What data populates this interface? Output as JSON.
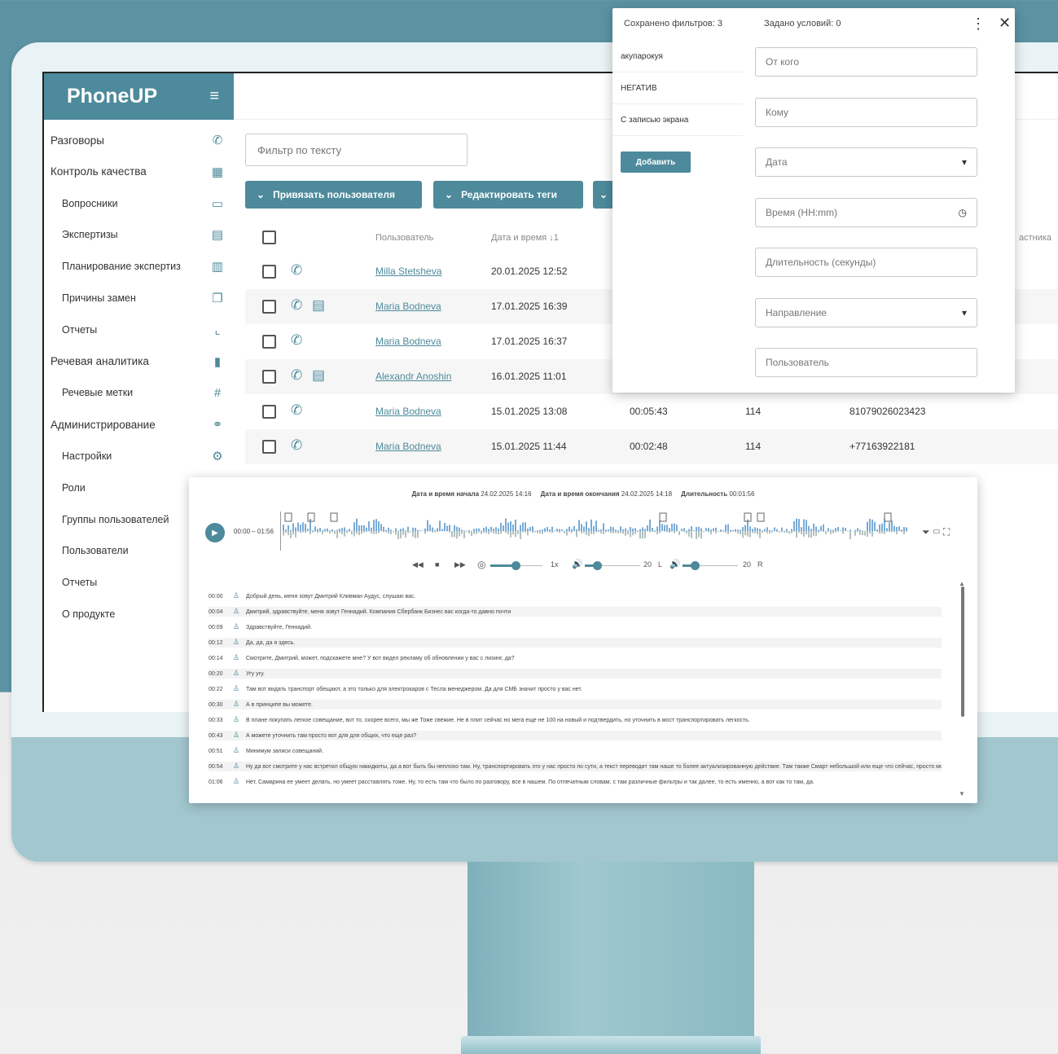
{
  "app": {
    "name": "PhoneUP"
  },
  "sidebar": {
    "items": [
      {
        "label": "Разговоры",
        "icon": "phone-icon",
        "glyph": "✆"
      },
      {
        "label": "Контроль качества",
        "icon": "qm-icon",
        "glyph": "▦"
      },
      {
        "label": "Вопросники",
        "icon": "folder-icon",
        "glyph": "▭"
      },
      {
        "label": "Экспертизы",
        "icon": "calendar-search-icon",
        "glyph": "▤"
      },
      {
        "label": "Планирование экспертиз",
        "icon": "calendar-clock-icon",
        "glyph": "▥"
      },
      {
        "label": "Причины замен",
        "icon": "copy-icon",
        "glyph": "❐"
      },
      {
        "label": "Отчеты",
        "icon": "chart-line-icon",
        "glyph": "⌞"
      },
      {
        "label": "Речевая аналитика",
        "icon": "bar-chart-icon",
        "glyph": "▮"
      },
      {
        "label": "Речевые метки",
        "icon": "hash-icon",
        "glyph": "#"
      },
      {
        "label": "Администрирование",
        "icon": "admin-icon",
        "glyph": "⚭"
      },
      {
        "label": "Настройки",
        "icon": "gear-icon",
        "glyph": "⚙"
      },
      {
        "label": "Роли",
        "icon": "",
        "glyph": ""
      },
      {
        "label": "Группы пользователей",
        "icon": "",
        "glyph": ""
      },
      {
        "label": "Пользователи",
        "icon": "",
        "glyph": ""
      },
      {
        "label": "Отчеты",
        "icon": "",
        "glyph": ""
      },
      {
        "label": "О продукте",
        "icon": "",
        "glyph": ""
      }
    ]
  },
  "main": {
    "filter_placeholder": "Фильтр по тексту",
    "buttons": [
      "Привязать пользователя",
      "Редактировать теги"
    ],
    "columns": {
      "user": "Пользователь",
      "datetime": "Дата и время",
      "last": "астника"
    },
    "rows": [
      {
        "user": "Milla Stetsheva",
        "datetime": "20.01.2025 12:52",
        "duration": "",
        "ext": "",
        "number": "",
        "transcript": false
      },
      {
        "user": "Maria Bodneva",
        "datetime": "17.01.2025 16:39",
        "duration": "",
        "ext": "",
        "number": "",
        "transcript": true
      },
      {
        "user": "Maria Bodneva",
        "datetime": "17.01.2025 16:37",
        "duration": "",
        "ext": "",
        "number": "",
        "transcript": false
      },
      {
        "user": "Alexandr Anoshin",
        "datetime": "16.01.2025 11:01",
        "duration": "",
        "ext": "",
        "number": "",
        "transcript": true
      },
      {
        "user": "Maria Bodneva",
        "datetime": "15.01.2025 13:08",
        "duration": "00:05:43",
        "ext": "114",
        "number": "81079026023423",
        "transcript": false
      },
      {
        "user": "Maria Bodneva",
        "datetime": "15.01.2025 11:44",
        "duration": "00:02:48",
        "ext": "114",
        "number": "+77163922181",
        "transcript": false
      }
    ]
  },
  "filter_panel": {
    "saved_count": "Сохранено фильтров: 3",
    "conditions_count": "Задано условий: 0",
    "saved_filters": [
      "акупарокуя",
      "НЕГАТИВ",
      "С записью экрана"
    ],
    "add_label": "Добавить",
    "fields": [
      {
        "label": "От кого",
        "suffix": ""
      },
      {
        "label": "Кому",
        "suffix": ""
      },
      {
        "label": "Дата",
        "suffix": "▾"
      },
      {
        "label": "Время (HH:mm)",
        "suffix": "◷"
      },
      {
        "label": "Длительность (секунды)",
        "suffix": ""
      },
      {
        "label": "Направление",
        "suffix": "▾"
      },
      {
        "label": "Пользователь",
        "suffix": ""
      }
    ]
  },
  "player": {
    "start_label": "Дата и время начала",
    "start_value": "24.02.2025 14:16",
    "end_label": "Дата и время окончания",
    "end_value": "24.02.2025 14:18",
    "duration_label": "Длительность",
    "duration_value": "00:01:56",
    "time_display": "00:00 – 01:56",
    "speed_value": "1x",
    "volume1_value": "20",
    "volume1_side": "L",
    "volume2_value": "20",
    "volume2_side": "R",
    "transcript": [
      {
        "time": "00:00",
        "text": "Добрый день, меня зовут Дмитрий Кливман Аудус, слушаю вас."
      },
      {
        "time": "00:04",
        "text": "Дмитрий, здравствуйте, меня зовут Геннадий. Компания Сбербанк Бизнес вас когда-то давно почти"
      },
      {
        "time": "00:09",
        "text": "Здравствуйте, Геннадий."
      },
      {
        "time": "00:12",
        "text": "Да, да, да я здесь."
      },
      {
        "time": "00:14",
        "text": "Смотрите, Дмитрий, может, подскажете мне? У вот видел рекламу об обновлении у вас с лизинг, да?"
      },
      {
        "time": "00:20",
        "text": "Угу угу."
      },
      {
        "time": "00:22",
        "text": "Там вот видать транспорт обещают, а это только для электрокаров с Тесла менеджером. Да для СМБ значит просто у вас нет."
      },
      {
        "time": "00:30",
        "text": "А в принципе вы можете."
      },
      {
        "time": "00:33",
        "text": "В плане покупать легкое совещание, вот то, скорее всего, мы же Тоже свежие. Не в плит сейчас но мега еще не 100 на новый и подтвердить, но уточнить в мост транспортировать легкость."
      },
      {
        "time": "00:43",
        "text": "А можете уточнить там просто вот для для общих, что еще раз?"
      },
      {
        "time": "00:51",
        "text": "Минимум записи совещаний."
      },
      {
        "time": "00:54",
        "text": "Ну да вот смотрите у нас встретил общую накидкиты, да а вот быть бы неплохо там. Ну, транспортировать это у нас просто по сути, а текст переводит там наше то более актуализированную действие. Там также Смарт небольшой или еще что сейчас, просто могу, да вот"
      },
      {
        "time": "01:06",
        "text": "Нет, Самарина ее умеет делать, но умеет расставлять тоже. Ну, то есть там что было по разговору, все в нашем. По отпечатным словам, с там различные фильтры и так далее, то есть именно, а вот как то там, да."
      }
    ]
  },
  "colors": {
    "accent": "#4d8a9b",
    "background": "#5b93a3"
  }
}
